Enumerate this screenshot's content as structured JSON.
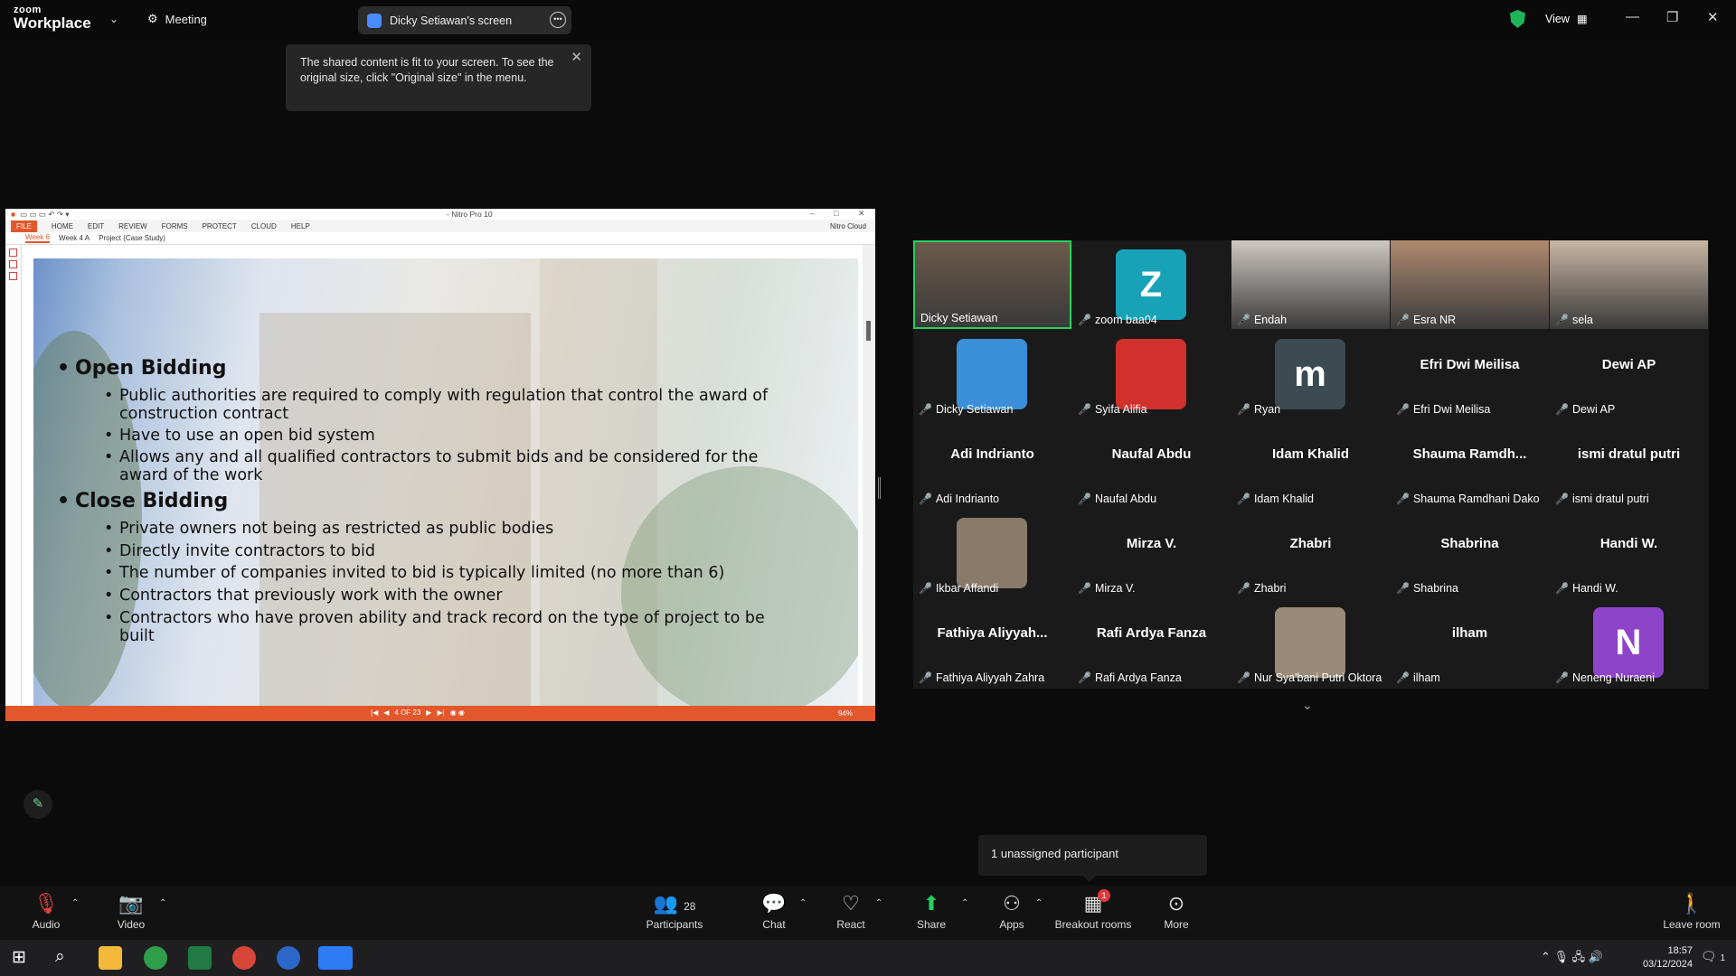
{
  "app": {
    "logo_top": "zoom",
    "logo_bottom": "Workplace",
    "meeting_label": "Meeting",
    "share_pill": "Dicky Setiawan's screen",
    "view_label": "View"
  },
  "tooltip": {
    "text": "The shared content is fit to your screen. To see the original size, click \"Original size\" in the menu."
  },
  "nitro": {
    "title": "- Nitro Pro 10",
    "menu": [
      "FILE",
      "HOME",
      "EDIT",
      "REVIEW",
      "FORMS",
      "PROTECT",
      "CLOUD",
      "HELP"
    ],
    "cloud": "Nitro Cloud",
    "tabs": [
      "Week 6",
      "Week 4 A",
      "Project (Case Study)"
    ],
    "page": "4 OF 23",
    "zoom": "94%"
  },
  "slide": {
    "h1": "Open Bidding",
    "open_items": [
      "Public authorities are required to comply with regulation that control the award of construction contract",
      "Have to use an open bid system",
      "Allows any and all qualified contractors to submit bids and be considered for the award of the work"
    ],
    "h2": "Close Bidding",
    "close_items": [
      "Private owners not being  as restricted as public bodies",
      "Directly invite contractors to bid",
      "The number  of companies invited to bid is typically limited (no more than 6)",
      "Contractors that previously work with the owner",
      "Contractors who have proven ability and track record on the type of project to be built"
    ]
  },
  "participants": [
    {
      "name": "Dicky Setiawan",
      "kind": "photo",
      "color": "#6b5a4a"
    },
    {
      "name": "zoom baa04",
      "kind": "avatar",
      "letter": "Z",
      "color": "#17a2b8"
    },
    {
      "name": "Endah",
      "kind": "photo",
      "color": "#cfc8c2"
    },
    {
      "name": "Esra NR",
      "kind": "photo",
      "color": "#b08a70"
    },
    {
      "name": "sela",
      "kind": "photo",
      "color": "#c9b6a4"
    },
    {
      "name": "Dicky Setiawan",
      "kind": "avatar",
      "letter": "",
      "color": "#3b8fd8"
    },
    {
      "name": "Syifa Alifia",
      "kind": "avatar",
      "letter": "",
      "color": "#d0312d"
    },
    {
      "name": "Ryan",
      "kind": "avatar",
      "letter": "m",
      "color": "#3c4a52"
    },
    {
      "name": "Efri Dwi Meilisa",
      "big": "Efri Dwi Meilisa",
      "kind": "text"
    },
    {
      "name": "Dewi AP",
      "big": "Dewi AP",
      "kind": "text"
    },
    {
      "name": "Adi Indrianto",
      "big": "Adi Indrianto",
      "kind": "text"
    },
    {
      "name": "Naufal Abdu",
      "big": "Naufal Abdu",
      "kind": "text"
    },
    {
      "name": "Idam Khalid",
      "big": "Idam Khalid",
      "kind": "text"
    },
    {
      "name": "Shauma Ramdhani Dako",
      "big": "Shauma  Ramdh...",
      "kind": "text"
    },
    {
      "name": "ismi dratul putri",
      "big": "ismi dratul putri",
      "kind": "text"
    },
    {
      "name": "Ikbar Affandi",
      "kind": "avatar",
      "letter": "",
      "color": "#8a7a6a"
    },
    {
      "name": "Mirza V.",
      "big": "Mirza V.",
      "kind": "text"
    },
    {
      "name": "Zhabri",
      "big": "Zhabri",
      "kind": "text"
    },
    {
      "name": "Shabrina",
      "big": "Shabrina",
      "kind": "text"
    },
    {
      "name": "Handi W.",
      "big": "Handi W.",
      "kind": "text"
    },
    {
      "name": "Fathiya Aliyyah Zahra",
      "big": "Fathiya  Aliyyah...",
      "kind": "text"
    },
    {
      "name": "Rafi Ardya Fanza",
      "big": "Rafi Ardya Fanza",
      "kind": "text"
    },
    {
      "name": "Nur Sya'bani Putri Oktora",
      "kind": "avatar",
      "letter": "",
      "color": "#9a8a7a"
    },
    {
      "name": "ilham",
      "big": "ilham",
      "kind": "text"
    },
    {
      "name": "Neneng Nuraeni",
      "kind": "avatar",
      "letter": "N",
      "color": "#8e44c9"
    }
  ],
  "unassigned": "1 unassigned participant",
  "toolbar": {
    "audio": "Audio",
    "video": "Video",
    "participants": "Participants",
    "participants_count": "28",
    "chat": "Chat",
    "react": "React",
    "share": "Share",
    "apps": "Apps",
    "breakout": "Breakout rooms",
    "breakout_badge": "1",
    "more": "More",
    "leave": "Leave room"
  },
  "taskbar": {
    "time": "18:57",
    "date": "03/12/2024",
    "notif": "1"
  }
}
